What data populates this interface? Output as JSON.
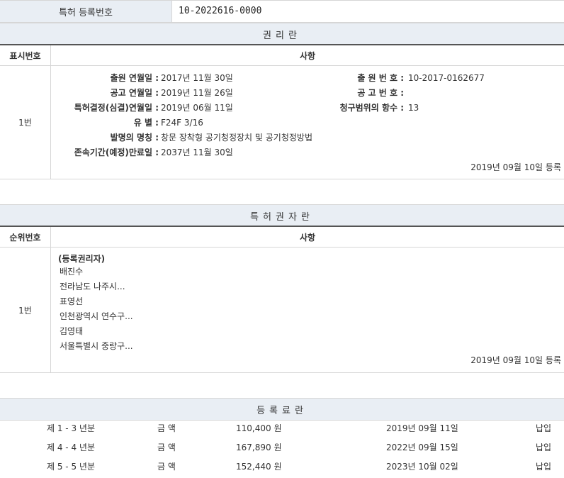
{
  "registration": {
    "label": "특허 등록번호",
    "number": "10-2022616-0000"
  },
  "rights_section": {
    "title": "권리란",
    "col_no": "표시번호",
    "col_detail": "사항",
    "row_no": "1번",
    "fields": {
      "app_date_label": "출원 연월일 :",
      "app_date": "2017년 11월 30일",
      "app_no_label": "출 원 번 호 :",
      "app_no": "10-2017-0162677",
      "pub_date_label": "공고 연월일 :",
      "pub_date": "2019년 11월 26일",
      "pub_no_label": "공 고 번 호 :",
      "pub_no": "",
      "decision_label": "특허결정(심결)연월일 :",
      "decision": "2019년 06월 11일",
      "claims_label": "청구범위의 항수 :",
      "claims": "13",
      "class_label": "유 별 :",
      "class": "F24F 3/16",
      "title_label": "발명의 명칭 :",
      "title": "창문 장착형 공기청정장치 및 공기청정방법",
      "expiry_label": "존속기간(예정)만료일 :",
      "expiry": "2037년 11월 30일"
    },
    "reg_date": "2019년 09월 10일 등록"
  },
  "holders_section": {
    "title": "특허권자란",
    "col_no": "순위번호",
    "col_detail": "사항",
    "row_no": "1번",
    "heading": "(등록권리자)",
    "lines": [
      "배진수",
      "전라남도 나주시...",
      "표영선",
      "인천광역시 연수구...",
      "김영태",
      "서울특별시 중랑구..."
    ],
    "reg_date": "2019년 09월 10일 등록"
  },
  "fees_section": {
    "title": "등록료란",
    "rows": [
      {
        "period": "제 1 - 3 년분",
        "label": "금 액",
        "amount": "110,400 원",
        "date": "2019년 09월 11일",
        "status": "납입"
      },
      {
        "period": "제 4 - 4 년분",
        "label": "금 액",
        "amount": "167,890 원",
        "date": "2022년 09월 15일",
        "status": "납입"
      },
      {
        "period": "제 5 - 5 년분",
        "label": "금 액",
        "amount": "152,440 원",
        "date": "2023년 10월 02일",
        "status": "납입"
      }
    ]
  }
}
